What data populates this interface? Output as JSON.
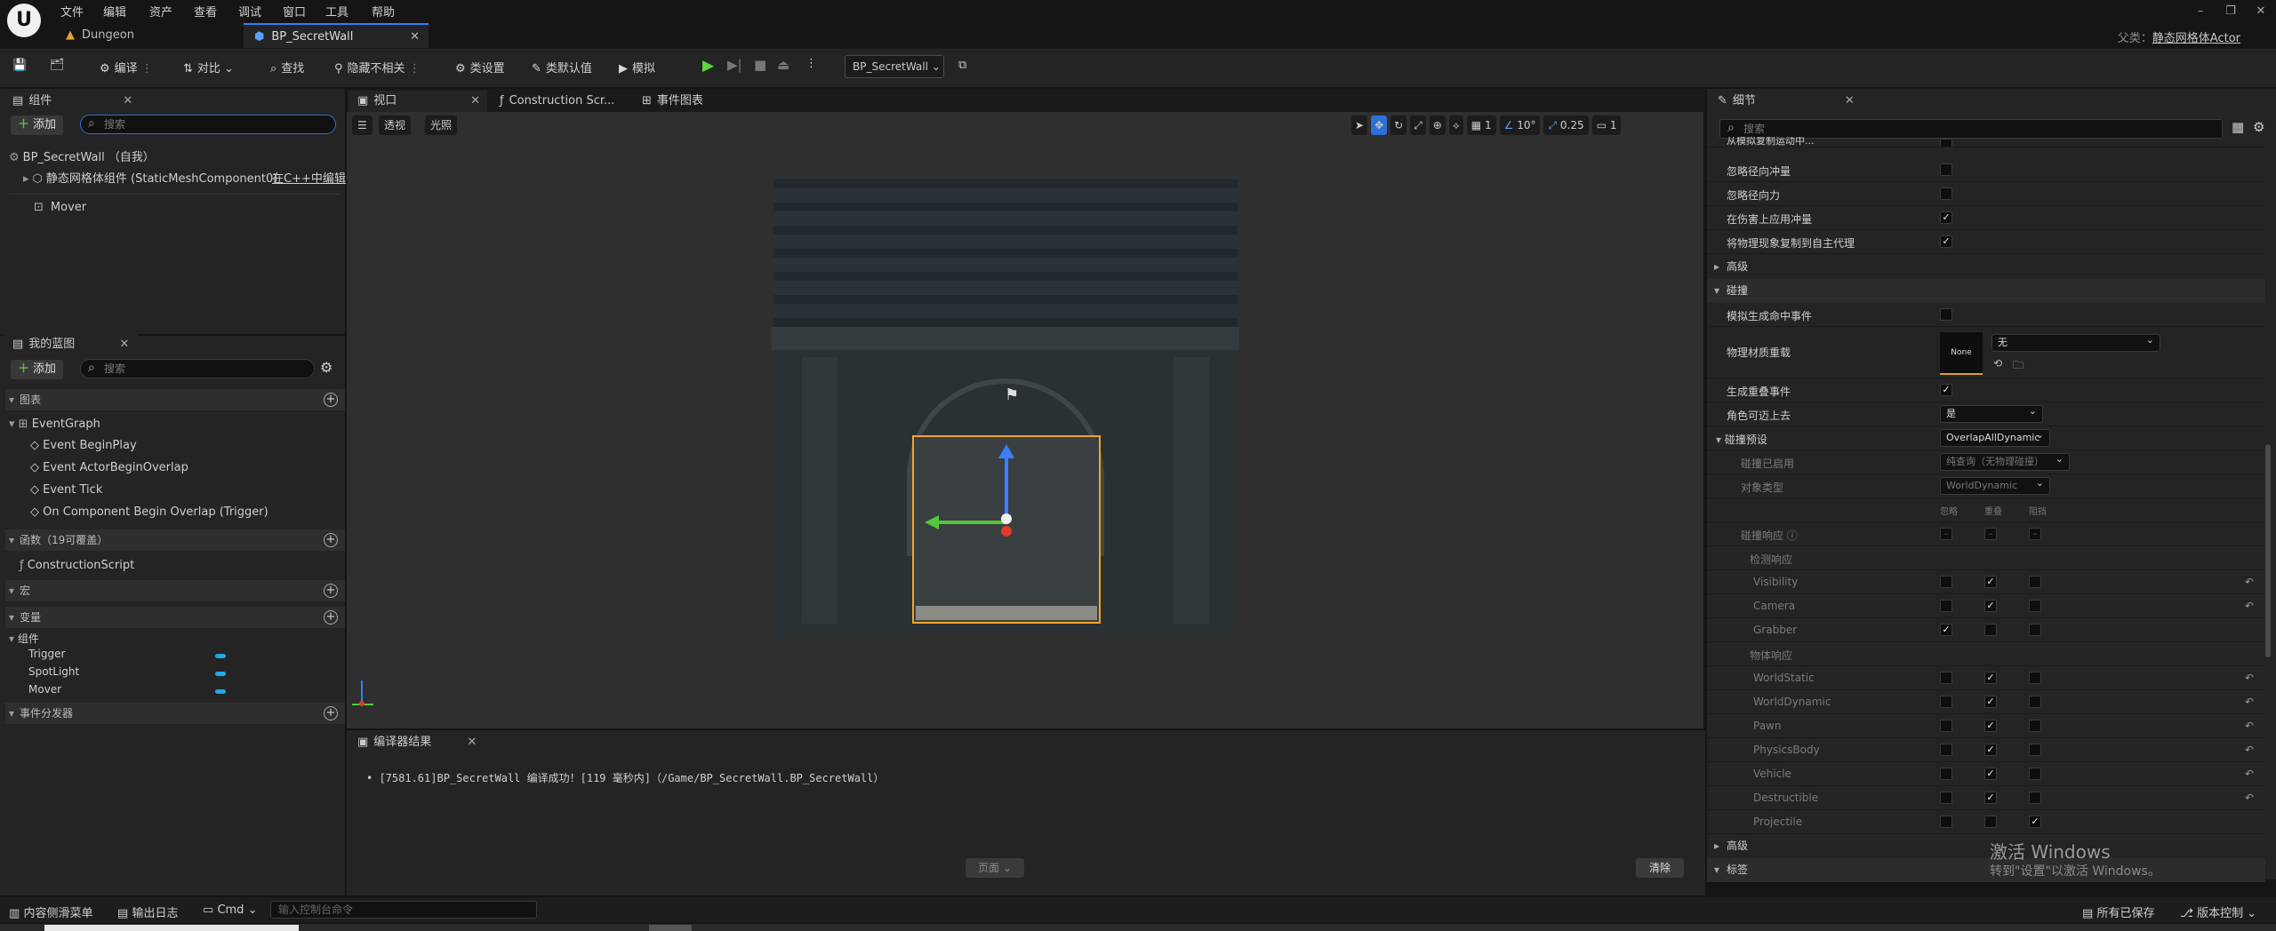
{
  "menu": {
    "items": [
      "文件",
      "编辑",
      "资产",
      "查看",
      "调试",
      "窗口",
      "工具",
      "帮助"
    ],
    "parent_label": "父类：",
    "parent_value": "静态网格体Actor"
  },
  "tabs": {
    "dungeon": "Dungeon",
    "secret_wall": "BP_SecretWall"
  },
  "toolbar": {
    "compile": "编译",
    "diff": "对比",
    "find": "查找",
    "hide_unrelated": "隐藏不相关",
    "class_settings": "类设置",
    "class_defaults": "类默认值",
    "simulate": "模拟",
    "debug_object": "BP_SecretWall"
  },
  "components": {
    "tab": "组件",
    "add": "添加",
    "search_placeholder": "搜索",
    "root": "BP_SecretWall （自我）",
    "static_mesh": "静态网格体组件 (StaticMeshComponent0)",
    "edit_in_cpp": "在C++中编辑",
    "mover": "Mover"
  },
  "my_blueprint": {
    "tab": "我的蓝图",
    "add": "添加",
    "search_placeholder": "搜索",
    "graphs_header": "图表",
    "event_graph": "EventGraph",
    "events": [
      "Event BeginPlay",
      "Event ActorBeginOverlap",
      "Event Tick",
      "On Component Begin Overlap (Trigger)"
    ],
    "functions_header": "函数（19可覆盖）",
    "construction_script": "ConstructionScript",
    "macros_header": "宏",
    "variables_header": "变量",
    "components_group": "组件",
    "variables": [
      "Trigger",
      "SpotLight",
      "Mover"
    ],
    "dispatchers_header": "事件分发器"
  },
  "center_tabs": {
    "viewport": "视口",
    "construction": "Construction Scr...",
    "event_graph": "事件图表"
  },
  "viewport": {
    "perspective": "透视",
    "lit": "光照",
    "grid_value": "1",
    "angle_value": "10°",
    "scale_value": "0.25",
    "camera_speed": "1"
  },
  "compiler": {
    "tab": "编译器结果",
    "message": "[7581.61]BP_SecretWall 编译成功！[119 毫秒内]（/Game/BP_SecretWall.BP_SecretWall）",
    "page_label": "页面",
    "clear": "清除"
  },
  "details": {
    "tab": "细节",
    "search_placeholder": "搜索",
    "truncated_row": "从模拟复制运动中...",
    "physics_rows": [
      "忽略径向冲量",
      "忽略径向力",
      "在伤害上应用冲量",
      "将物理现象复制到自主代理"
    ],
    "advanced": "高级",
    "collision_section": "碰撞",
    "sim_hit_events": "模拟生成命中事件",
    "phys_material_override": "物理材质重载",
    "phys_material_thumb": "None",
    "phys_material_value": "无",
    "gen_overlap_events": "生成重叠事件",
    "can_step_up": "角色可迈上去",
    "can_step_up_value": "是",
    "collision_presets": "碰撞预设",
    "collision_presets_value": "OverlapAllDynamic",
    "collision_enabled": "碰撞已启用",
    "collision_enabled_value": "纯查询（无物理碰撞）",
    "object_type": "对象类型",
    "object_type_value": "WorldDynamic",
    "col_headers": [
      "忽略",
      "重叠",
      "阻挡"
    ],
    "collision_responses": "碰撞响应",
    "trace_responses": "检测响应",
    "trace_channels": [
      "Visibility",
      "Camera",
      "Grabber"
    ],
    "object_responses": "物体响应",
    "object_channels": [
      "WorldStatic",
      "WorldDynamic",
      "Pawn",
      "PhysicsBody",
      "Vehicle",
      "Destructible",
      "Projectile"
    ],
    "advanced2": "高级",
    "tags": "标签"
  },
  "watermark": {
    "line1": "激活 Windows",
    "line2": "转到\"设置\"以激活 Windows。"
  },
  "statusbar": {
    "content_drawer": "内容侧滑菜单",
    "output_log": "输出日志",
    "cmd": "Cmd",
    "console_placeholder": "输入控制台命令",
    "all_saved": "所有已保存",
    "source_control": "版本控制"
  }
}
